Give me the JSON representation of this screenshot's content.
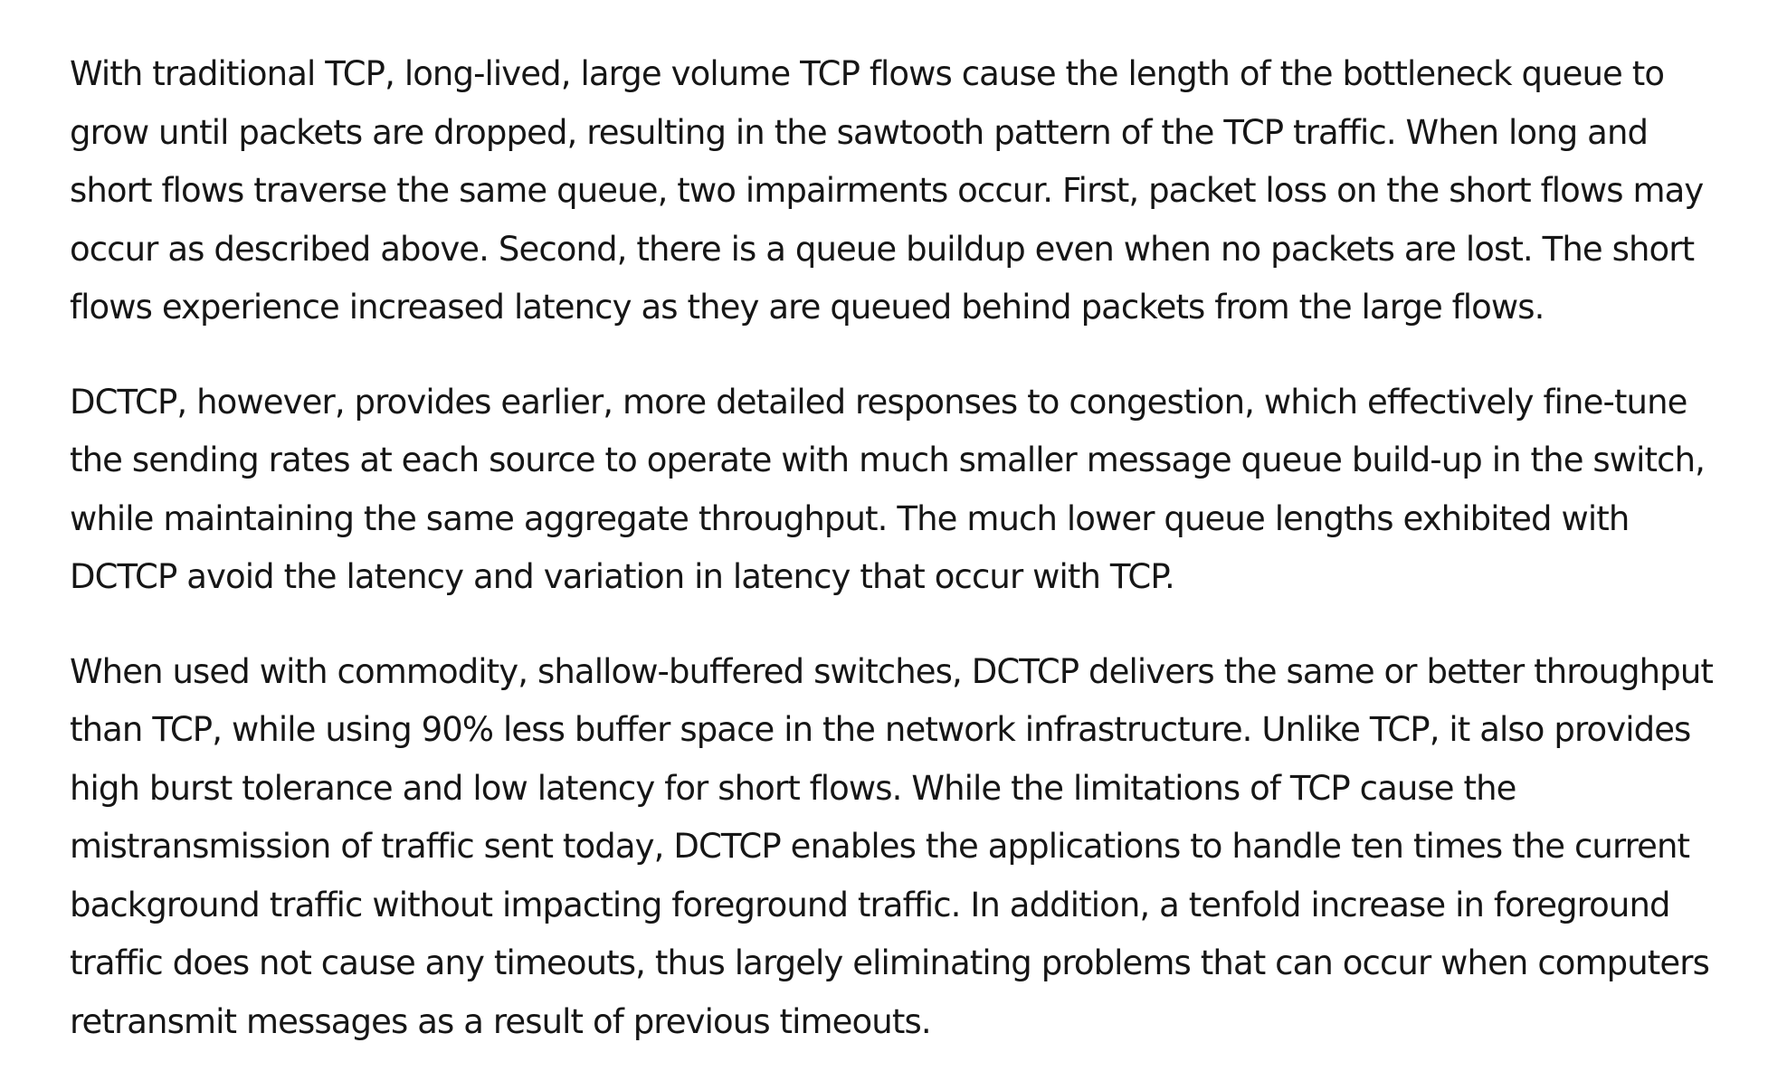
{
  "article": {
    "paragraphs": [
      "With traditional TCP, long-lived, large volume TCP flows cause the length of the bottleneck queue to grow until packets are dropped, resulting in the sawtooth pattern of the TCP traffic. When long and short flows traverse the same queue, two impairments occur. First, packet loss on the short flows may occur as described above. Second, there is a queue buildup even when no packets are lost. The short flows experience increased latency as they are queued behind packets from the large flows.",
      "DCTCP, however, provides earlier, more detailed responses to congestion, which effectively fine-tune the sending rates at each source to operate with much smaller message queue build-up in the switch, while maintaining the same aggregate throughput. The much lower queue lengths exhibited with DCTCP avoid the latency and variation in latency that occur with TCP.",
      "When used with commodity, shallow-buffered switches, DCTCP delivers the same or better throughput than TCP, while using 90% less buffer space in the network infrastructure. Unlike TCP, it also provides high burst tolerance and low latency for short flows. While the limitations of TCP cause the mistransmission of traffic sent today, DCTCP enables the applications to handle ten times the current background traffic without impacting foreground traffic. In addition, a tenfold increase in foreground traffic does not cause any timeouts, thus largely eliminating problems that can occur when computers retransmit messages as a result of previous timeouts."
    ]
  }
}
